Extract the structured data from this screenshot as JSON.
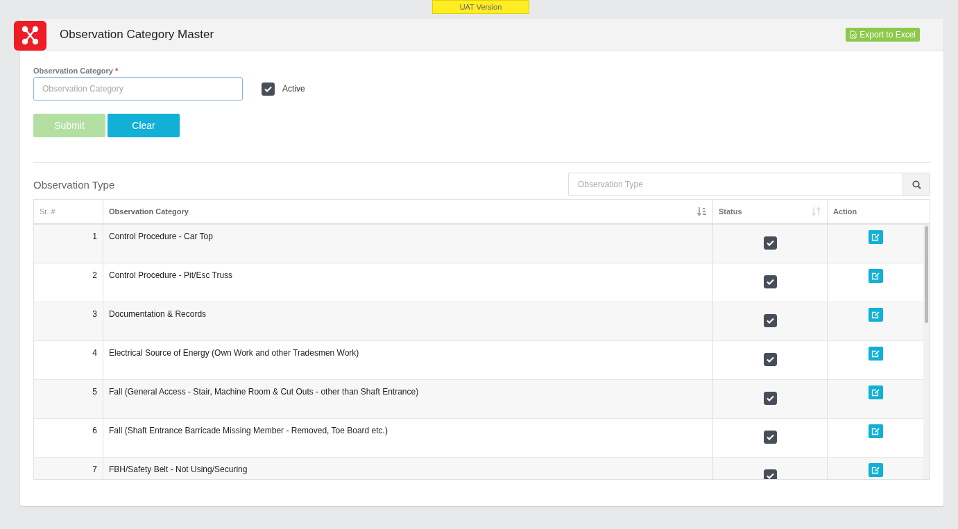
{
  "badge": "UAT Version",
  "header": {
    "title": "Observation Category Master",
    "export_button": "Export to Excel"
  },
  "form": {
    "label": "Observation Category",
    "required_mark": "*",
    "placeholder": "Observation Category",
    "active": {
      "label": "Active",
      "checked": true
    },
    "buttons": [
      {
        "label": "Submit",
        "kind": "submit",
        "disabled": true
      },
      {
        "label": "Clear",
        "kind": "clear",
        "disabled": false
      }
    ]
  },
  "list": {
    "title": "Observation Type",
    "search_placeholder": "Observation Type",
    "columns": [
      {
        "label": "Sr. #",
        "sortable": false,
        "sorted": false
      },
      {
        "label": "Observation Category",
        "sortable": true,
        "sorted": true
      },
      {
        "label": "Status",
        "sortable": true,
        "sorted": false
      },
      {
        "label": "Action",
        "sortable": false,
        "sorted": false
      }
    ],
    "rows": [
      {
        "sr": "1",
        "category": "Control Procedure - Car Top",
        "checked": true
      },
      {
        "sr": "2",
        "category": "Control Procedure - Pit/Esc Truss",
        "checked": true
      },
      {
        "sr": "3",
        "category": "Documentation & Records",
        "checked": true
      },
      {
        "sr": "4",
        "category": "Electrical Source of Energy (Own Work and other Tradesmen Work)",
        "checked": true
      },
      {
        "sr": "5",
        "category": "Fall (General Access - Stair, Machine Room & Cut Outs - other than Shaft Entrance)",
        "checked": true
      },
      {
        "sr": "6",
        "category": "Fall (Shaft Entrance Barricade Missing Member - Removed, Toe Board etc.)",
        "checked": true
      },
      {
        "sr": "7",
        "category": "FBH/Safety Belt - Not Using/Securing",
        "checked": true
      }
    ]
  }
}
